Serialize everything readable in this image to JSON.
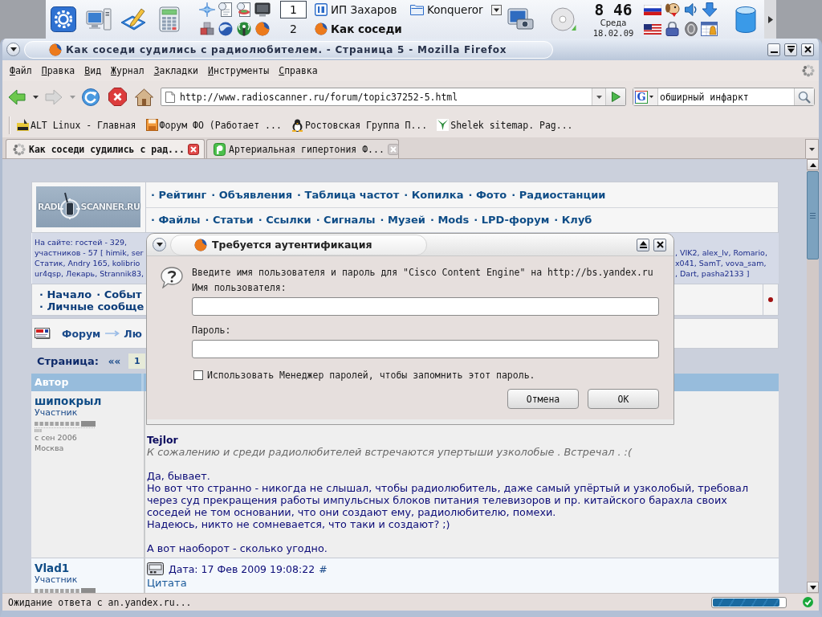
{
  "taskbar": {
    "pager": [
      {
        "label": "1",
        "selected": true
      },
      {
        "label": "2",
        "selected": false
      }
    ],
    "tasks": [
      {
        "label": "ИП Захаров",
        "selected": false,
        "grouped": false
      },
      {
        "label": "Konqueror",
        "selected": false,
        "grouped": true
      },
      {
        "label": "Как соседи",
        "selected": true,
        "grouped": false
      }
    ],
    "clock": {
      "time": "8 46",
      "day": "Среда",
      "date": "18.02.09"
    }
  },
  "window": {
    "title": "Как соседи судились с радиолюбителем. - Страница 5 - Mozilla Firefox"
  },
  "menu": [
    "Файл",
    "Правка",
    "Вид",
    "Журнал",
    "Закладки",
    "Инструменты",
    "Справка"
  ],
  "toolbar": {
    "url": "http://www.radioscanner.ru/forum/topic37252-5.html",
    "search_engine": "G",
    "search_value": "обширный инфаркт"
  },
  "bookmarks": [
    "ALT Linux - Главная",
    "Форум ФО (Работает ...",
    "Ростовская Группа П...",
    "Shelek sitemap. Pag..."
  ],
  "tabs": [
    {
      "label": "Как соседи судились с рад...",
      "selected": true
    },
    {
      "label": "Артериальная гипертония Ф...",
      "selected": false
    }
  ],
  "page": {
    "logo": [
      "RADI",
      "SCANNER.RU"
    ],
    "nav_rows": [
      [
        "· Рейтинг",
        "· Объявления",
        "· Таблица частот",
        "· Копилка",
        "· Фото",
        "· Радиостанции"
      ],
      [
        "· Файлы",
        "· Статьи",
        "· Ссылки",
        "· Сигналы",
        "· Музей",
        "· Mods",
        "· LPD-форум",
        "· Клуб"
      ]
    ],
    "online": {
      "left": [
        "На сайте: гостей - 329,",
        "участников - 57 [ himik, ser",
        "Статик, Andry 165, kolibrio",
        "ur4qsp, Лекарь, Strannik83,"
      ],
      "right": [
        ", VIK2, alex_lv, Romario,",
        "x041, SamT, vova_sam,",
        ", Dart, pasha2133 ]"
      ]
    },
    "user_menu": [
      [
        "· Начало",
        "· Событ"
      ],
      [
        "· Личные сообще"
      ]
    ],
    "breadcrumb": [
      "Форум",
      "Лю"
    ],
    "pagination": {
      "label": "Страница:",
      "first": "««",
      "pages": [
        "1"
      ]
    },
    "columns": [
      "Автор"
    ],
    "posts": [
      {
        "author": "шипокрыл",
        "role": "Участник",
        "since": "с сен 2006",
        "city": "Москва",
        "quote_author": "Tejlor",
        "quote": "К сожалению и среди радиолюбителей встречаются упертыши узколобые . Встречал . :(",
        "paragraphs": [
          [
            "Да, бывает.",
            "Но вот что странно - никогда не слышал, чтобы радиолюбитель, даже самый упёртый и узколобый, требовал через суд прекращения работы импульсных блоков питания телевизоров и пр. китайского барахла своих соседей не том основании, что они создают ему, радиолюбителю, помехи.",
            "Надеюсь, никто не сомневается, что таки и создают? ;)"
          ],
          [
            "А вот наоборот - сколько угодно."
          ]
        ]
      },
      {
        "author": "Vlad1",
        "role": "Участник",
        "date": "Дата: 17 Фев 2009 19:08:22",
        "anchor": "#",
        "quote_link": "Цитата"
      }
    ]
  },
  "dialog": {
    "title": "Требуется аутентификация",
    "message": "Введите имя пользователя и пароль для \"Cisco Content Engine\" на http://bs.yandex.ru",
    "fields": [
      {
        "label": "Имя пользователя:"
      },
      {
        "label": "Пароль:"
      }
    ],
    "remember": {
      "label": "Использовать Менеджер паролей, чтобы запомнить этот пароль.",
      "checked": false
    },
    "buttons": [
      "Отмена",
      "OK"
    ]
  },
  "status_bar": {
    "text": "Ожидание ответа с an.yandex.ru...",
    "level": 0.92
  }
}
